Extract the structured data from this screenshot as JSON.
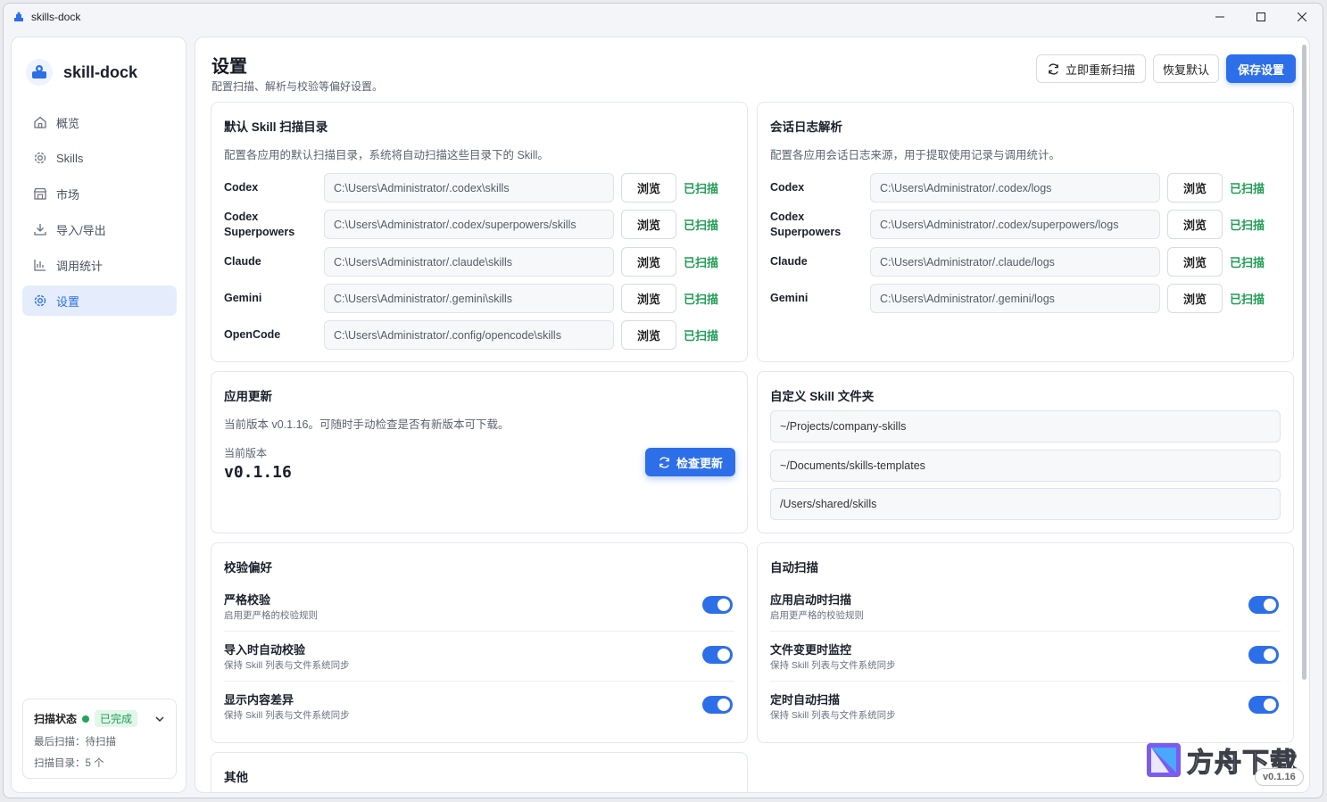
{
  "window": {
    "title": "skills-dock"
  },
  "sidebar": {
    "brand": "skill-dock",
    "items": [
      {
        "label": "概览",
        "icon": "home-icon"
      },
      {
        "label": "Skills",
        "icon": "gear-icon"
      },
      {
        "label": "市场",
        "icon": "store-icon"
      },
      {
        "label": "导入/导出",
        "icon": "download-icon"
      },
      {
        "label": "调用统计",
        "icon": "bar-chart-icon"
      },
      {
        "label": "设置",
        "icon": "settings-icon",
        "active": true
      }
    ],
    "scan_status": {
      "label": "扫描状态",
      "badge": "已完成",
      "last_scan": "最后扫描：待扫描",
      "scan_dirs": "扫描目录：5 个"
    }
  },
  "header": {
    "title": "设置",
    "subtitle": "配置扫描、解析与校验等偏好设置。",
    "rescan_label": "立即重新扫描",
    "restore_label": "恢复默认",
    "save_label": "保存设置"
  },
  "default_dirs": {
    "title": "默认 Skill 扫描目录",
    "desc": "配置各应用的默认扫描目录，系统将自动扫描这些目录下的 Skill。",
    "rows": [
      {
        "label": "Codex",
        "path": "C:\\Users\\Administrator/.codex\\skills",
        "browse": "浏览",
        "status": "已扫描"
      },
      {
        "label": "Codex Superpowers",
        "path": "C:\\Users\\Administrator/.codex/superpowers/skills",
        "browse": "浏览",
        "status": "已扫描"
      },
      {
        "label": "Claude",
        "path": "C:\\Users\\Administrator/.claude\\skills",
        "browse": "浏览",
        "status": "已扫描"
      },
      {
        "label": "Gemini",
        "path": "C:\\Users\\Administrator/.gemini\\skills",
        "browse": "浏览",
        "status": "已扫描"
      },
      {
        "label": "OpenCode",
        "path": "C:\\Users\\Administrator/.config/opencode\\skills",
        "browse": "浏览",
        "status": "已扫描"
      }
    ]
  },
  "log_parse": {
    "title": "会话日志解析",
    "desc": "配置各应用会话日志来源，用于提取使用记录与调用统计。",
    "rows": [
      {
        "label": "Codex",
        "path": "C:\\Users\\Administrator/.codex/logs",
        "browse": "浏览",
        "status": "已扫描"
      },
      {
        "label": "Codex Superpowers",
        "path": "C:\\Users\\Administrator/.codex/superpowers/logs",
        "browse": "浏览",
        "status": "已扫描"
      },
      {
        "label": "Claude",
        "path": "C:\\Users\\Administrator/.claude/logs",
        "browse": "浏览",
        "status": "已扫描"
      },
      {
        "label": "Gemini",
        "path": "C:\\Users\\Administrator/.gemini/logs",
        "browse": "浏览",
        "status": "已扫描"
      }
    ]
  },
  "app_update": {
    "title": "应用更新",
    "desc": "当前版本 v0.1.16。可随时手动检查是否有新版本可下载。",
    "version_label": "当前版本",
    "version": "v0.1.16",
    "check_label": "检查更新"
  },
  "custom_folders": {
    "title": "自定义 Skill 文件夹",
    "items": [
      "~/Projects/company-skills",
      "~/Documents/skills-templates",
      "/Users/shared/skills"
    ]
  },
  "validation": {
    "title": "校验偏好",
    "items": [
      {
        "title": "严格校验",
        "desc": "启用更严格的校验规则",
        "on": true
      },
      {
        "title": "导入时自动校验",
        "desc": "保持 Skill 列表与文件系统同步",
        "on": true
      },
      {
        "title": "显示内容差异",
        "desc": "保持 Skill 列表与文件系统同步",
        "on": true
      }
    ]
  },
  "auto_scan": {
    "title": "自动扫描",
    "items": [
      {
        "title": "应用启动时扫描",
        "desc": "启用更严格的校验规则",
        "on": true
      },
      {
        "title": "文件变更时监控",
        "desc": "保持 Skill 列表与文件系统同步",
        "on": true
      },
      {
        "title": "定时自动扫描",
        "desc": "保持 Skill 列表与文件系统同步",
        "on": true
      }
    ]
  },
  "other": {
    "title": "其他"
  },
  "watermark": {
    "text": "方舟下载"
  },
  "version_badge": "v0.1.16",
  "colors": {
    "accent": "#2d6fe8",
    "success": "#1f9d55"
  }
}
